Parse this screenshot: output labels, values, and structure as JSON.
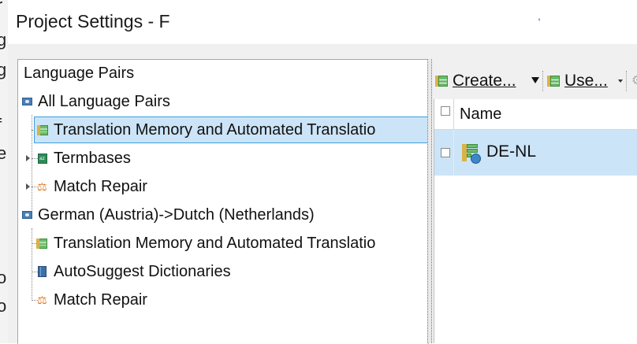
{
  "window": {
    "title": "Project Settings - F",
    "background_letters": [
      "r",
      "g",
      "g",
      "f",
      "e",
      "o",
      "o"
    ]
  },
  "tree": {
    "root_label": "Language Pairs",
    "nodes": [
      {
        "label": "All Language Pairs",
        "icon": "language-pair-icon",
        "level": 0
      },
      {
        "label": "Translation Memory and Automated Translatio",
        "icon": "translation-memory-icon",
        "level": 1,
        "selected": true
      },
      {
        "label": "Termbases",
        "icon": "termbase-icon",
        "level": 1,
        "expandable": true
      },
      {
        "label": "Match Repair",
        "icon": "wrench-icon",
        "level": 1,
        "expandable": true
      },
      {
        "label": "German (Austria)->Dutch (Netherlands)",
        "icon": "language-pair-icon",
        "level": 0
      },
      {
        "label": "Translation Memory and Automated Translatio",
        "icon": "translation-memory-icon",
        "level": 1
      },
      {
        "label": "AutoSuggest Dictionaries",
        "icon": "dictionary-icon",
        "level": 1
      },
      {
        "label": "Match Repair",
        "icon": "wrench-icon",
        "level": 1
      }
    ]
  },
  "toolbar": {
    "create_label": "Create...",
    "use_label": "Use..."
  },
  "grid": {
    "columns": [
      "Name"
    ],
    "rows": [
      {
        "name": "DE-NL",
        "checked": false,
        "selected": true
      }
    ]
  },
  "colors": {
    "selection": "#cce4f7",
    "selection_border": "#3c9fe0",
    "dialog_bg": "#f0f0f0",
    "wrench": "#e07a1f"
  }
}
